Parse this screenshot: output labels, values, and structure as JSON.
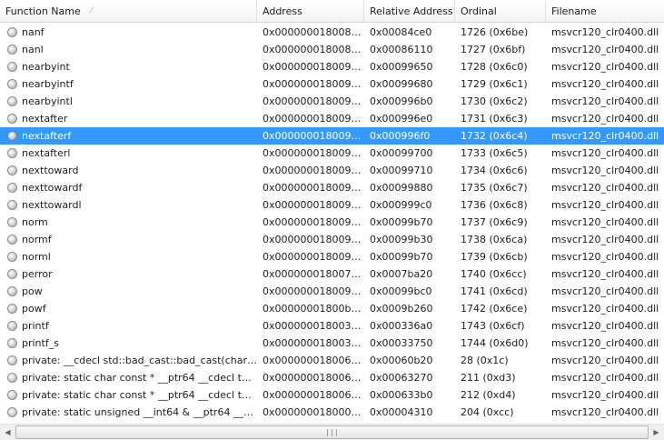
{
  "columns": {
    "function_name": "Function Name",
    "address": "Address",
    "relative_address": "Relative Address",
    "ordinal": "Ordinal",
    "filename": "Filename"
  },
  "rows": [
    {
      "name": "nanf",
      "address": "0x0000000180084c...",
      "rel": "0x00084ce0",
      "ordinal": "1726 (0x6be)",
      "file": "msvcr120_clr0400.dll"
    },
    {
      "name": "nanl",
      "address": "0x000000018008611...",
      "rel": "0x00086110",
      "ordinal": "1727 (0x6bf)",
      "file": "msvcr120_clr0400.dll"
    },
    {
      "name": "nearbyint",
      "address": "0x00000001800996...",
      "rel": "0x00099650",
      "ordinal": "1728 (0x6c0)",
      "file": "msvcr120_clr0400.dll"
    },
    {
      "name": "nearbyintf",
      "address": "0x00000001800996...",
      "rel": "0x00099680",
      "ordinal": "1729 (0x6c1)",
      "file": "msvcr120_clr0400.dll"
    },
    {
      "name": "nearbyintl",
      "address": "0x00000001800996...",
      "rel": "0x000996b0",
      "ordinal": "1730 (0x6c2)",
      "file": "msvcr120_clr0400.dll"
    },
    {
      "name": "nextafter",
      "address": "0x00000001800996...",
      "rel": "0x000996e0",
      "ordinal": "1731 (0x6c3)",
      "file": "msvcr120_clr0400.dll"
    },
    {
      "name": "nextafterf",
      "address": "0x00000001800996f0",
      "rel": "0x000996f0",
      "ordinal": "1732 (0x6c4)",
      "file": "msvcr120_clr0400.dll"
    },
    {
      "name": "nextafterl",
      "address": "0x00000001800997...",
      "rel": "0x00099700",
      "ordinal": "1733 (0x6c5)",
      "file": "msvcr120_clr0400.dll"
    },
    {
      "name": "nexttoward",
      "address": "0x00000001800997...",
      "rel": "0x00099710",
      "ordinal": "1734 (0x6c6)",
      "file": "msvcr120_clr0400.dll"
    },
    {
      "name": "nexttowardf",
      "address": "0x00000001800998...",
      "rel": "0x00099880",
      "ordinal": "1735 (0x6c7)",
      "file": "msvcr120_clr0400.dll"
    },
    {
      "name": "nexttowardl",
      "address": "0x00000001800999...",
      "rel": "0x000999c0",
      "ordinal": "1736 (0x6c8)",
      "file": "msvcr120_clr0400.dll"
    },
    {
      "name": "norm",
      "address": "0x0000000180099b...",
      "rel": "0x00099b70",
      "ordinal": "1737 (0x6c9)",
      "file": "msvcr120_clr0400.dll"
    },
    {
      "name": "normf",
      "address": "0x0000000180099b...",
      "rel": "0x00099b30",
      "ordinal": "1738 (0x6ca)",
      "file": "msvcr120_clr0400.dll"
    },
    {
      "name": "norml",
      "address": "0x0000000180099b...",
      "rel": "0x00099b70",
      "ordinal": "1739 (0x6cb)",
      "file": "msvcr120_clr0400.dll"
    },
    {
      "name": "perror",
      "address": "0x000000018007ba...",
      "rel": "0x0007ba20",
      "ordinal": "1740 (0x6cc)",
      "file": "msvcr120_clr0400.dll"
    },
    {
      "name": "pow",
      "address": "0x0000000180099b...",
      "rel": "0x00099bc0",
      "ordinal": "1741 (0x6cd)",
      "file": "msvcr120_clr0400.dll"
    },
    {
      "name": "powf",
      "address": "0x00000001800b2...",
      "rel": "0x0009b260",
      "ordinal": "1742 (0x6ce)",
      "file": "msvcr120_clr0400.dll"
    },
    {
      "name": "printf",
      "address": "0x00000001800336...",
      "rel": "0x000336a0",
      "ordinal": "1743 (0x6cf)",
      "file": "msvcr120_clr0400.dll"
    },
    {
      "name": "printf_s",
      "address": "0x00000001800337...",
      "rel": "0x00033750",
      "ordinal": "1744 (0x6d0)",
      "file": "msvcr120_clr0400.dll"
    },
    {
      "name": "private: __cdecl std::bad_cast::bad_cast(char co...",
      "address": "0x0000000180060b...",
      "rel": "0x00060b20",
      "ordinal": "28 (0x1c)",
      "file": "msvcr120_clr0400.dll"
    },
    {
      "name": "private: static char const * __ptr64 __cdecl type_...",
      "address": "0x00000001800632...",
      "rel": "0x00063270",
      "ordinal": "211 (0xd3)",
      "file": "msvcr120_clr0400.dll"
    },
    {
      "name": "private: static char const * __ptr64 __cdecl type_...",
      "address": "0x00000001800633...",
      "rel": "0x000633b0",
      "ordinal": "212 (0xd4)",
      "file": "msvcr120_clr0400.dll"
    },
    {
      "name": "private: static unsigned __int64 & __ptr64 __cde...",
      "address": "0x00000001800043...",
      "rel": "0x00004310",
      "ordinal": "204 (0xcc)",
      "file": "msvcr120_clr0400.dll"
    }
  ],
  "selected_index": 6,
  "colors": {
    "selection": "#3399ff",
    "selection_text": "#ffffff"
  },
  "scrollbar": {
    "left_arrow": "◀",
    "right_arrow": "▶",
    "grip": "|||"
  }
}
